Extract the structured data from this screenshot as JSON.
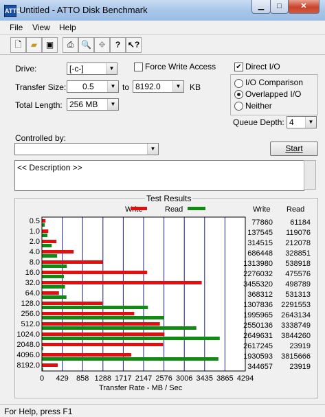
{
  "window": {
    "title": "Untitled - ATTO Disk Benchmark",
    "icon_text": "ATTO"
  },
  "menu": [
    "File",
    "View",
    "Help"
  ],
  "toolbar": [
    "new-icon",
    "open-icon",
    "save-icon",
    "print-icon",
    "print-preview-icon",
    "move-icon",
    "help-icon",
    "context-help-icon"
  ],
  "form": {
    "drive_label": "Drive:",
    "drive_value": "[-c-]",
    "force_write_label": "Force Write Access",
    "direct_io_label": "Direct I/O",
    "transfer_label": "Transfer Size:",
    "transfer_from": "0.5",
    "to_label": "to",
    "transfer_to": "8192.0",
    "kb_label": "KB",
    "total_length_label": "Total Length:",
    "total_length_value": "256 MB",
    "io_comparison_label": "I/O Comparison",
    "overlapped_label": "Overlapped I/O",
    "neither_label": "Neither",
    "queue_depth_label": "Queue Depth:",
    "queue_depth_value": "4",
    "controlled_by_label": "Controlled by:",
    "controlled_by_value": "",
    "start_label": "Start",
    "description_text": "<< Description >>"
  },
  "results": {
    "title": "Test Results",
    "write_legend": "Write",
    "read_legend": "Read",
    "write_col": "Write",
    "read_col": "Read",
    "xlabel": "Transfer Rate - MB / Sec",
    "colors": {
      "write": "#e01010",
      "read": "#118a11",
      "grid": "#1b1b8c"
    }
  },
  "chart_data": {
    "type": "bar",
    "orientation": "horizontal",
    "title": "Test Results",
    "xlabel": "Transfer Rate - MB / Sec",
    "categories": [
      "0.5",
      "1.0",
      "2.0",
      "4.0",
      "8.0",
      "16.0",
      "32.0",
      "64.0",
      "128.0",
      "256.0",
      "512.0",
      "1024.0",
      "2048.0",
      "4096.0",
      "8192.0"
    ],
    "xticks": [
      "0",
      "429",
      "858",
      "1288",
      "1717",
      "2147",
      "2576",
      "3006",
      "3435",
      "3865",
      "4294"
    ],
    "xlim": [
      0,
      4294
    ],
    "series": [
      {
        "name": "Write",
        "values": [
          77860,
          137545,
          314515,
          686448,
          1313980,
          2276032,
          3455320,
          368312,
          1307836,
          1995965,
          2550136,
          2649631,
          2617245,
          1930593,
          344657
        ],
        "labels": [
          "77860",
          "137545",
          "314515",
          "686448",
          "1313980",
          "2276032",
          "3455320",
          "368312",
          "1307836",
          "1995965",
          "2550136",
          "2649631",
          "2617245",
          "1930593",
          "344657"
        ]
      },
      {
        "name": "Read",
        "values": [
          61184,
          119076,
          212078,
          328851,
          538918,
          475576,
          498789,
          531313,
          2291553,
          2643134,
          3338749,
          3844260,
          23919,
          3815666,
          23919
        ],
        "labels": [
          "61184",
          "119076",
          "212078",
          "328851",
          "538918",
          "475576",
          "498789",
          "531313",
          "2291553",
          "2643134",
          "3338749",
          "3844260",
          "23919",
          "3815666",
          "23919"
        ]
      }
    ]
  },
  "status": "For Help, press F1"
}
